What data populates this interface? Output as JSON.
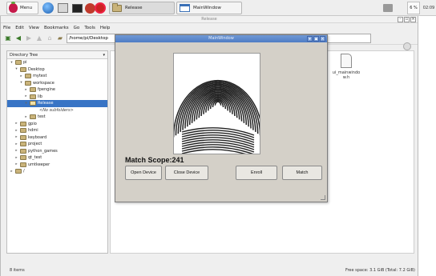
{
  "taskbar": {
    "menu_label": "Menu",
    "tasks": [
      {
        "label": "Release"
      },
      {
        "label": "MainWindow"
      }
    ],
    "cpu_label": "6 %",
    "clock": "02:09"
  },
  "file_manager": {
    "title": "Release",
    "menu": [
      "File",
      "Edit",
      "View",
      "Bookmarks",
      "Go",
      "Tools",
      "Help"
    ],
    "path": "/home/pi/Desktop",
    "sidebar_header": "Directory Tree",
    "tree": [
      {
        "label": "pi",
        "indent": 0,
        "twisty": "▾"
      },
      {
        "label": "Desktop",
        "indent": 1,
        "twisty": "▾"
      },
      {
        "label": "mytest",
        "indent": 2,
        "twisty": "▸"
      },
      {
        "label": "workspace",
        "indent": 2,
        "twisty": "▾"
      },
      {
        "label": "fpengine",
        "indent": 3,
        "twisty": "▸"
      },
      {
        "label": "lib",
        "indent": 3,
        "twisty": "▸"
      },
      {
        "label": "Release",
        "indent": 3,
        "twisty": "▾",
        "selected": true
      },
      {
        "label": "<No subfolders>",
        "indent": 5,
        "twisty": "",
        "italic": true
      },
      {
        "label": "test",
        "indent": 3,
        "twisty": "▸"
      },
      {
        "label": "gpio",
        "indent": 1,
        "twisty": "▸"
      },
      {
        "label": "hdmi",
        "indent": 1,
        "twisty": "▸"
      },
      {
        "label": "keyboard",
        "indent": 1,
        "twisty": "▸"
      },
      {
        "label": "project",
        "indent": 1,
        "twisty": "▸"
      },
      {
        "label": "python_games",
        "indent": 1,
        "twisty": "▸"
      },
      {
        "label": "qt_test",
        "indent": 1,
        "twisty": "▸"
      },
      {
        "label": "umtkeeper",
        "indent": 1,
        "twisty": "▸"
      },
      {
        "label": "/",
        "indent": 0,
        "twisty": "▸"
      }
    ],
    "files": [
      {
        "name": "ui_mainwindo\nw.h"
      }
    ],
    "status_left": "8 items",
    "status_right": "Free space: 3.1 GiB (Total: 7.2 GiB)"
  },
  "dialog": {
    "title": "MainWindow",
    "match_label": "Match Scope:241",
    "buttons": {
      "open": "Open Device",
      "close": "Close Device",
      "enroll": "Enroll",
      "match": "Match"
    }
  }
}
